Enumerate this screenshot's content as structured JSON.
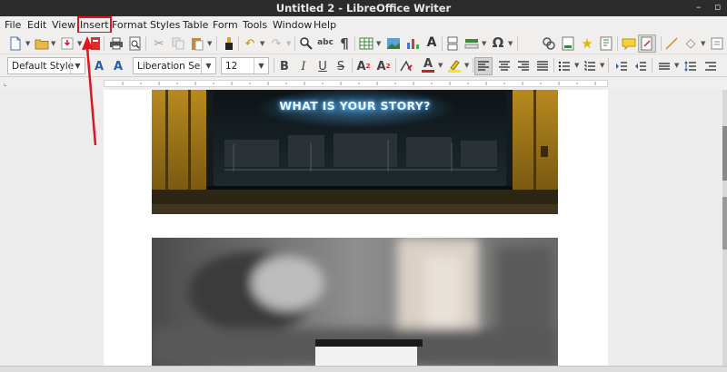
{
  "window": {
    "title": "Untitled 2 - LibreOffice Writer"
  },
  "menu": [
    "File",
    "Edit",
    "View",
    "Insert",
    "Format",
    "Styles",
    "Table",
    "Form",
    "Tools",
    "Window",
    "Help"
  ],
  "formatting": {
    "paragraph_style": "Default Style",
    "font_name": "Liberation Se",
    "font_size": "12"
  },
  "document": {
    "image1_text": "WHAT IS YOUR STORY?"
  },
  "icons": {
    "toolbar1": [
      "new-document-icon",
      "open-folder-icon",
      "save-icon",
      "export-pdf-icon",
      "print-icon",
      "print-preview-icon",
      "cut-icon",
      "copy-icon",
      "paste-icon",
      "clone-formatting-icon",
      "undo-icon",
      "redo-icon",
      "find-replace-icon",
      "spelling-icon",
      "formatting-marks-icon",
      "insert-table-icon",
      "insert-image-icon",
      "insert-chart-icon",
      "insert-textbox-icon",
      "insert-page-break-icon",
      "insert-field-icon",
      "insert-special-character-icon",
      "insert-hyperlink-icon",
      "insert-footnote-icon",
      "insert-endnote-icon",
      "insert-bookmark-icon",
      "insert-cross-reference-icon",
      "insert-comment-icon",
      "track-changes-icon",
      "insert-line-icon",
      "basic-shapes-icon"
    ],
    "toolbar2": [
      "set-paragraph-style-icon",
      "new-style-icon",
      "bold-icon",
      "italic-icon",
      "underline-icon",
      "strikethrough-icon",
      "superscript-icon",
      "subscript-icon",
      "clear-formatting-icon",
      "font-color-icon",
      "highlighting-color-icon",
      "align-left-icon",
      "align-center-icon",
      "align-right-icon",
      "justify-icon",
      "unordered-list-icon",
      "ordered-list-icon",
      "increase-indent-icon",
      "decrease-indent-icon",
      "line-spacing-icon",
      "paragraph-spacing-icon"
    ]
  },
  "colors": {
    "annotation": "#e0151d",
    "font_color": "#c9211e",
    "highlight": "#ffe21a"
  }
}
